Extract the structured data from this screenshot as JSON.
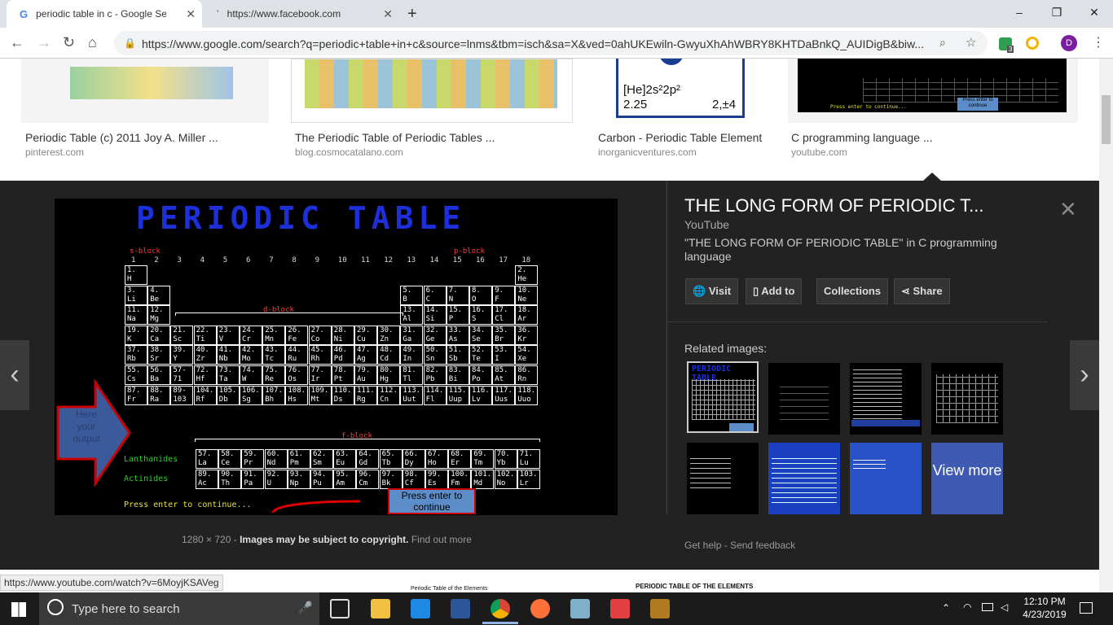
{
  "tabs": [
    {
      "title": "periodic table in c - Google Searc",
      "active": true
    },
    {
      "title": "https://www.facebook.com",
      "active": false
    }
  ],
  "new_tab": "+",
  "window": {
    "minimize": "–",
    "restore": "❐",
    "close": "✕"
  },
  "toolbar": {
    "back": "←",
    "forward": "→",
    "reload": "↻",
    "home": "⌂",
    "url": "https://www.google.com/search?q=periodic+table+in+c&source=lnms&tbm=isch&sa=X&ved=0ahUKEwiln-GwyuXhAhWBRY8KHTDaBnkQ_AUIDigB&biw...",
    "extension_badge": "3",
    "profile": "D"
  },
  "results": [
    {
      "title": "Periodic Table (c) 2011 Joy A. Miller ...",
      "source": "pinterest.com"
    },
    {
      "title": "The Periodic Table of Periodic Tables ...",
      "source": "blog.cosmocatalano.com"
    },
    {
      "title": "Carbon - Periodic Table Element",
      "source": "inorganicventures.com"
    },
    {
      "title": "C programming language ...",
      "source": "youtube.com"
    }
  ],
  "carbon_thumb": {
    "config": "[He]2s²2p²",
    "mass": "2.25",
    "ox": "2,±4"
  },
  "youtube_thumb": {
    "prompt": "Press enter to continue...",
    "box": "Press enter to continue"
  },
  "big_image": {
    "title": "PERIODIC TABLE",
    "s_block": "s-block",
    "p_block": "p-block",
    "d_block": "d-block",
    "f_block": "f-block",
    "groups": [
      "1",
      "2",
      "3",
      "4",
      "5",
      "6",
      "7",
      "8",
      "9",
      "10",
      "11",
      "12",
      "13",
      "14",
      "15",
      "16",
      "17",
      "18"
    ],
    "lanthanides": "Lanthanides",
    "actinides": "Actinides",
    "press": "Press enter to continue...",
    "press_box": "Press enter to continue",
    "arrow_text": "Here your output",
    "elements": [
      {
        "n": "1.",
        "s": "H",
        "c": 1,
        "r": 1
      },
      {
        "n": "2.",
        "s": "He",
        "c": 18,
        "r": 1
      },
      {
        "n": "3.",
        "s": "Li",
        "c": 1,
        "r": 2
      },
      {
        "n": "4.",
        "s": "Be",
        "c": 2,
        "r": 2
      },
      {
        "n": "5.",
        "s": "B",
        "c": 13,
        "r": 2
      },
      {
        "n": "6.",
        "s": "C",
        "c": 14,
        "r": 2
      },
      {
        "n": "7.",
        "s": "N",
        "c": 15,
        "r": 2
      },
      {
        "n": "8.",
        "s": "O",
        "c": 16,
        "r": 2
      },
      {
        "n": "9.",
        "s": "F",
        "c": 17,
        "r": 2
      },
      {
        "n": "10.",
        "s": "Ne",
        "c": 18,
        "r": 2
      },
      {
        "n": "11.",
        "s": "Na",
        "c": 1,
        "r": 3
      },
      {
        "n": "12.",
        "s": "Mg",
        "c": 2,
        "r": 3
      },
      {
        "n": "13.",
        "s": "Al",
        "c": 13,
        "r": 3
      },
      {
        "n": "14.",
        "s": "Si",
        "c": 14,
        "r": 3
      },
      {
        "n": "15.",
        "s": "P",
        "c": 15,
        "r": 3
      },
      {
        "n": "16.",
        "s": "S",
        "c": 16,
        "r": 3
      },
      {
        "n": "17.",
        "s": "Cl",
        "c": 17,
        "r": 3
      },
      {
        "n": "18.",
        "s": "Ar",
        "c": 18,
        "r": 3
      },
      {
        "n": "19.",
        "s": "K",
        "c": 1,
        "r": 4
      },
      {
        "n": "20.",
        "s": "Ca",
        "c": 2,
        "r": 4
      },
      {
        "n": "21.",
        "s": "Sc",
        "c": 3,
        "r": 4
      },
      {
        "n": "22.",
        "s": "Ti",
        "c": 4,
        "r": 4
      },
      {
        "n": "23.",
        "s": "V",
        "c": 5,
        "r": 4
      },
      {
        "n": "24.",
        "s": "Cr",
        "c": 6,
        "r": 4
      },
      {
        "n": "25.",
        "s": "Mn",
        "c": 7,
        "r": 4
      },
      {
        "n": "26.",
        "s": "Fe",
        "c": 8,
        "r": 4
      },
      {
        "n": "27.",
        "s": "Co",
        "c": 9,
        "r": 4
      },
      {
        "n": "28.",
        "s": "Ni",
        "c": 10,
        "r": 4
      },
      {
        "n": "29.",
        "s": "Cu",
        "c": 11,
        "r": 4
      },
      {
        "n": "30.",
        "s": "Zn",
        "c": 12,
        "r": 4
      },
      {
        "n": "31.",
        "s": "Ga",
        "c": 13,
        "r": 4
      },
      {
        "n": "32.",
        "s": "Ge",
        "c": 14,
        "r": 4
      },
      {
        "n": "33.",
        "s": "As",
        "c": 15,
        "r": 4
      },
      {
        "n": "34.",
        "s": "Se",
        "c": 16,
        "r": 4
      },
      {
        "n": "35.",
        "s": "Br",
        "c": 17,
        "r": 4
      },
      {
        "n": "36.",
        "s": "Kr",
        "c": 18,
        "r": 4
      },
      {
        "n": "37.",
        "s": "Rb",
        "c": 1,
        "r": 5
      },
      {
        "n": "38.",
        "s": "Sr",
        "c": 2,
        "r": 5
      },
      {
        "n": "39.",
        "s": "Y",
        "c": 3,
        "r": 5
      },
      {
        "n": "40.",
        "s": "Zr",
        "c": 4,
        "r": 5
      },
      {
        "n": "41.",
        "s": "Nb",
        "c": 5,
        "r": 5
      },
      {
        "n": "42.",
        "s": "Mo",
        "c": 6,
        "r": 5
      },
      {
        "n": "43.",
        "s": "Tc",
        "c": 7,
        "r": 5
      },
      {
        "n": "44.",
        "s": "Ru",
        "c": 8,
        "r": 5
      },
      {
        "n": "45.",
        "s": "Rh",
        "c": 9,
        "r": 5
      },
      {
        "n": "46.",
        "s": "Pd",
        "c": 10,
        "r": 5
      },
      {
        "n": "47.",
        "s": "Ag",
        "c": 11,
        "r": 5
      },
      {
        "n": "48.",
        "s": "Cd",
        "c": 12,
        "r": 5
      },
      {
        "n": "49.",
        "s": "In",
        "c": 13,
        "r": 5
      },
      {
        "n": "50.",
        "s": "Sn",
        "c": 14,
        "r": 5
      },
      {
        "n": "51.",
        "s": "Sb",
        "c": 15,
        "r": 5
      },
      {
        "n": "52.",
        "s": "Te",
        "c": 16,
        "r": 5
      },
      {
        "n": "53.",
        "s": "I",
        "c": 17,
        "r": 5
      },
      {
        "n": "54.",
        "s": "Xe",
        "c": 18,
        "r": 5
      },
      {
        "n": "55.",
        "s": "Cs",
        "c": 1,
        "r": 6
      },
      {
        "n": "56.",
        "s": "Ba",
        "c": 2,
        "r": 6
      },
      {
        "n": "57-",
        "s": "71",
        "c": 3,
        "r": 6
      },
      {
        "n": "72.",
        "s": "Hf",
        "c": 4,
        "r": 6
      },
      {
        "n": "73.",
        "s": "Ta",
        "c": 5,
        "r": 6
      },
      {
        "n": "74.",
        "s": "W",
        "c": 6,
        "r": 6
      },
      {
        "n": "75.",
        "s": "Re",
        "c": 7,
        "r": 6
      },
      {
        "n": "76.",
        "s": "Os",
        "c": 8,
        "r": 6
      },
      {
        "n": "77.",
        "s": "Ir",
        "c": 9,
        "r": 6
      },
      {
        "n": "78.",
        "s": "Pt",
        "c": 10,
        "r": 6
      },
      {
        "n": "79.",
        "s": "Au",
        "c": 11,
        "r": 6
      },
      {
        "n": "80.",
        "s": "Hg",
        "c": 12,
        "r": 6
      },
      {
        "n": "81.",
        "s": "Tl",
        "c": 13,
        "r": 6
      },
      {
        "n": "82.",
        "s": "Pb",
        "c": 14,
        "r": 6
      },
      {
        "n": "83.",
        "s": "Bi",
        "c": 15,
        "r": 6
      },
      {
        "n": "84.",
        "s": "Po",
        "c": 16,
        "r": 6
      },
      {
        "n": "85.",
        "s": "At",
        "c": 17,
        "r": 6
      },
      {
        "n": "86.",
        "s": "Rn",
        "c": 18,
        "r": 6
      },
      {
        "n": "87.",
        "s": "Fr",
        "c": 1,
        "r": 7
      },
      {
        "n": "88.",
        "s": "Ra",
        "c": 2,
        "r": 7
      },
      {
        "n": "89-",
        "s": "103",
        "c": 3,
        "r": 7
      },
      {
        "n": "104.",
        "s": "Rf",
        "c": 4,
        "r": 7
      },
      {
        "n": "105.",
        "s": "Db",
        "c": 5,
        "r": 7
      },
      {
        "n": "106.",
        "s": "Sg",
        "c": 6,
        "r": 7
      },
      {
        "n": "107.",
        "s": "Bh",
        "c": 7,
        "r": 7
      },
      {
        "n": "108.",
        "s": "Hs",
        "c": 8,
        "r": 7
      },
      {
        "n": "109.",
        "s": "Mt",
        "c": 9,
        "r": 7
      },
      {
        "n": "110.",
        "s": "Ds",
        "c": 10,
        "r": 7
      },
      {
        "n": "111.",
        "s": "Rg",
        "c": 11,
        "r": 7
      },
      {
        "n": "112.",
        "s": "Cn",
        "c": 12,
        "r": 7
      },
      {
        "n": "113.",
        "s": "Uut",
        "c": 13,
        "r": 7
      },
      {
        "n": "114.",
        "s": "Fl",
        "c": 14,
        "r": 7
      },
      {
        "n": "115.",
        "s": "Uup",
        "c": 15,
        "r": 7
      },
      {
        "n": "116.",
        "s": "Lv",
        "c": 16,
        "r": 7
      },
      {
        "n": "117.",
        "s": "Uus",
        "c": 17,
        "r": 7
      },
      {
        "n": "118.",
        "s": "Uuo",
        "c": 18,
        "r": 7
      }
    ],
    "f_elements": [
      {
        "n": "57.",
        "s": "La",
        "c": 1,
        "r": 1
      },
      {
        "n": "58.",
        "s": "Ce",
        "c": 2,
        "r": 1
      },
      {
        "n": "59.",
        "s": "Pr",
        "c": 3,
        "r": 1
      },
      {
        "n": "60.",
        "s": "Nd",
        "c": 4,
        "r": 1
      },
      {
        "n": "61.",
        "s": "Pm",
        "c": 5,
        "r": 1
      },
      {
        "n": "62.",
        "s": "Sm",
        "c": 6,
        "r": 1
      },
      {
        "n": "63.",
        "s": "Eu",
        "c": 7,
        "r": 1
      },
      {
        "n": "64.",
        "s": "Gd",
        "c": 8,
        "r": 1
      },
      {
        "n": "65.",
        "s": "Tb",
        "c": 9,
        "r": 1
      },
      {
        "n": "66.",
        "s": "Dy",
        "c": 10,
        "r": 1
      },
      {
        "n": "67.",
        "s": "Ho",
        "c": 11,
        "r": 1
      },
      {
        "n": "68.",
        "s": "Er",
        "c": 12,
        "r": 1
      },
      {
        "n": "69.",
        "s": "Tm",
        "c": 13,
        "r": 1
      },
      {
        "n": "70.",
        "s": "Yb",
        "c": 14,
        "r": 1
      },
      {
        "n": "71.",
        "s": "Lu",
        "c": 15,
        "r": 1
      },
      {
        "n": "89.",
        "s": "Ac",
        "c": 1,
        "r": 2
      },
      {
        "n": "90.",
        "s": "Th",
        "c": 2,
        "r": 2
      },
      {
        "n": "91.",
        "s": "Pa",
        "c": 3,
        "r": 2
      },
      {
        "n": "92.",
        "s": "U",
        "c": 4,
        "r": 2
      },
      {
        "n": "93.",
        "s": "Np",
        "c": 5,
        "r": 2
      },
      {
        "n": "94.",
        "s": "Pu",
        "c": 6,
        "r": 2
      },
      {
        "n": "95.",
        "s": "Am",
        "c": 7,
        "r": 2
      },
      {
        "n": "96.",
        "s": "Cm",
        "c": 8,
        "r": 2
      },
      {
        "n": "97.",
        "s": "Bk",
        "c": 9,
        "r": 2
      },
      {
        "n": "98.",
        "s": "Cf",
        "c": 10,
        "r": 2
      },
      {
        "n": "99.",
        "s": "Es",
        "c": 11,
        "r": 2
      },
      {
        "n": "100.",
        "s": "Fm",
        "c": 12,
        "r": 2
      },
      {
        "n": "101.",
        "s": "Md",
        "c": 13,
        "r": 2
      },
      {
        "n": "102.",
        "s": "No",
        "c": 14,
        "r": 2
      },
      {
        "n": "103.",
        "s": "Lr",
        "c": 15,
        "r": 2
      }
    ]
  },
  "info": {
    "title": "THE LONG FORM OF PERIODIC T...",
    "source": "YouTube",
    "description": "\"THE LONG FORM OF PERIODIC TABLE\" in C programming language",
    "actions": [
      "Visit",
      "Add to",
      "Collections",
      "Share"
    ],
    "related_header": "Related images:",
    "view_more": "View more",
    "close": "✕"
  },
  "meta": {
    "size": "1280 × 720",
    "sep": "-",
    "copyright": "Images may be subject to copyright.",
    "find_out": "Find out more"
  },
  "help": {
    "get_help": "Get help",
    "sep": "-",
    "send_feedback": "Send feedback"
  },
  "status_url": "https://www.youtube.com/watch?v=6MoyjKSAVeg",
  "bottom_strip": {
    "left": "Periodic Table of the Elements",
    "right": "PERIODIC TABLE OF THE ELEMENTS"
  },
  "taskbar": {
    "search_placeholder": "Type here to search",
    "time": "12:10 PM",
    "date": "4/23/2019"
  },
  "colors": {
    "panel_bg": "#222222",
    "title_blue": "#1c2fd8",
    "label_red": "#ff3b3b",
    "label_green": "#2ad12a",
    "prompt_yellow": "#e8e330"
  }
}
